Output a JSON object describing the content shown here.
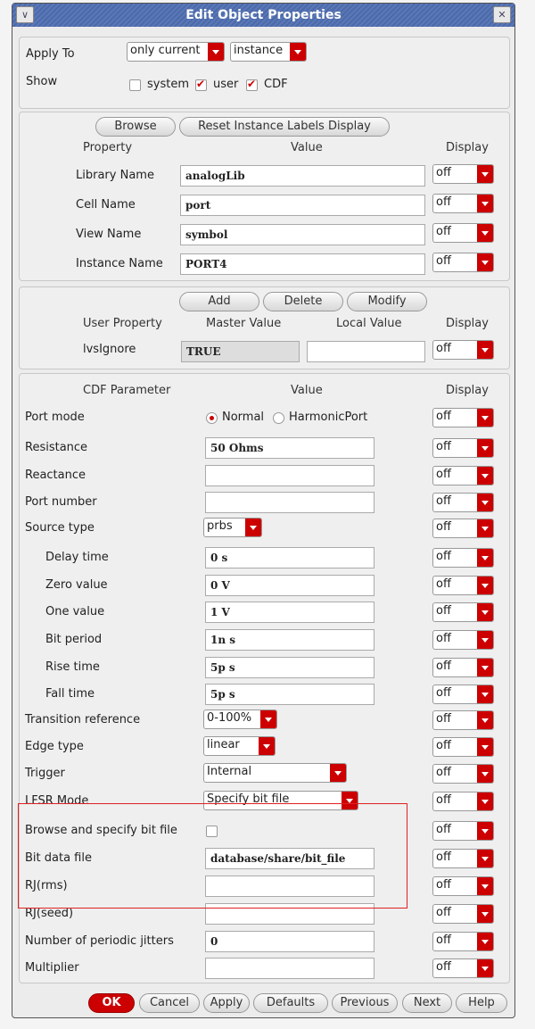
{
  "window": {
    "title": "Edit Object Properties"
  },
  "apply": {
    "apply_to_label": "Apply To",
    "scope": "only current",
    "type": "instance",
    "show_label": "Show",
    "show": [
      {
        "label": "system",
        "checked": false
      },
      {
        "label": "user",
        "checked": true
      },
      {
        "label": "CDF",
        "checked": true
      }
    ]
  },
  "properties": {
    "browse": "Browse",
    "reset": "Reset Instance Labels Display",
    "headers": {
      "property": "Property",
      "value": "Value",
      "display": "Display"
    },
    "rows": [
      {
        "label": "Library Name",
        "value": "analogLib",
        "display": "off"
      },
      {
        "label": "Cell Name",
        "value": "port",
        "display": "off"
      },
      {
        "label": "View Name",
        "value": "symbol",
        "display": "off"
      },
      {
        "label": "Instance Name",
        "value": "PORT4",
        "display": "off"
      }
    ]
  },
  "user_props": {
    "add": "Add",
    "delete": "Delete",
    "modify": "Modify",
    "headers": {
      "property": "User Property",
      "master": "Master Value",
      "local": "Local Value",
      "display": "Display"
    },
    "rows": [
      {
        "label": "lvsIgnore",
        "master": "TRUE",
        "local": "",
        "display": "off"
      }
    ]
  },
  "cdf": {
    "headers": {
      "param": "CDF Parameter",
      "value": "Value",
      "display": "Display"
    },
    "rows": [
      {
        "label": "Port mode",
        "kind": "radio",
        "options": [
          "Normal",
          "HarmonicPort"
        ],
        "selected": 0,
        "display": "off"
      },
      {
        "label": "Resistance",
        "kind": "text",
        "value": "50 Ohms",
        "display": "off"
      },
      {
        "label": "Reactance",
        "kind": "text",
        "value": "",
        "display": "off"
      },
      {
        "label": "Port number",
        "kind": "text",
        "value": "",
        "display": "off"
      },
      {
        "label": "Source type",
        "kind": "select",
        "value": "prbs",
        "display": "off"
      },
      {
        "label": "Delay time",
        "kind": "text",
        "value": "0 s",
        "indent": true,
        "display": "off"
      },
      {
        "label": "Zero value",
        "kind": "text",
        "value": "0 V",
        "indent": true,
        "display": "off"
      },
      {
        "label": "One value",
        "kind": "text",
        "value": "1 V",
        "indent": true,
        "display": "off"
      },
      {
        "label": "Bit period",
        "kind": "text",
        "value": "1n s",
        "indent": true,
        "display": "off"
      },
      {
        "label": "Rise time",
        "kind": "text",
        "value": "5p s",
        "indent": true,
        "display": "off"
      },
      {
        "label": "Fall time",
        "kind": "text",
        "value": "5p s",
        "indent": true,
        "display": "off"
      },
      {
        "label": "Transition reference",
        "kind": "select",
        "value": "0-100%",
        "display": "off"
      },
      {
        "label": "Edge type",
        "kind": "select",
        "value": "linear",
        "display": "off"
      },
      {
        "label": "Trigger",
        "kind": "select",
        "value": "Internal",
        "display": "off"
      },
      {
        "label": "LFSR Mode",
        "kind": "select",
        "value": "Specify bit file",
        "display": "off"
      },
      {
        "label": "Browse and specify bit file",
        "kind": "checkbox",
        "checked": false,
        "display": "off"
      },
      {
        "label": "Bit data file",
        "kind": "text",
        "value": "database/share/bit_file",
        "display": "off"
      },
      {
        "label": "RJ(rms)",
        "kind": "text",
        "value": "",
        "display": "off"
      },
      {
        "label": "RJ(seed)",
        "kind": "text",
        "value": "",
        "display": "off"
      },
      {
        "label": "Number of periodic jitters",
        "kind": "text",
        "value": "0",
        "display": "off"
      },
      {
        "label": "Multiplier",
        "kind": "text",
        "value": "",
        "display": "off"
      }
    ]
  },
  "buttons": [
    "OK",
    "Cancel",
    "Apply",
    "Defaults",
    "Previous",
    "Next",
    "Help"
  ]
}
